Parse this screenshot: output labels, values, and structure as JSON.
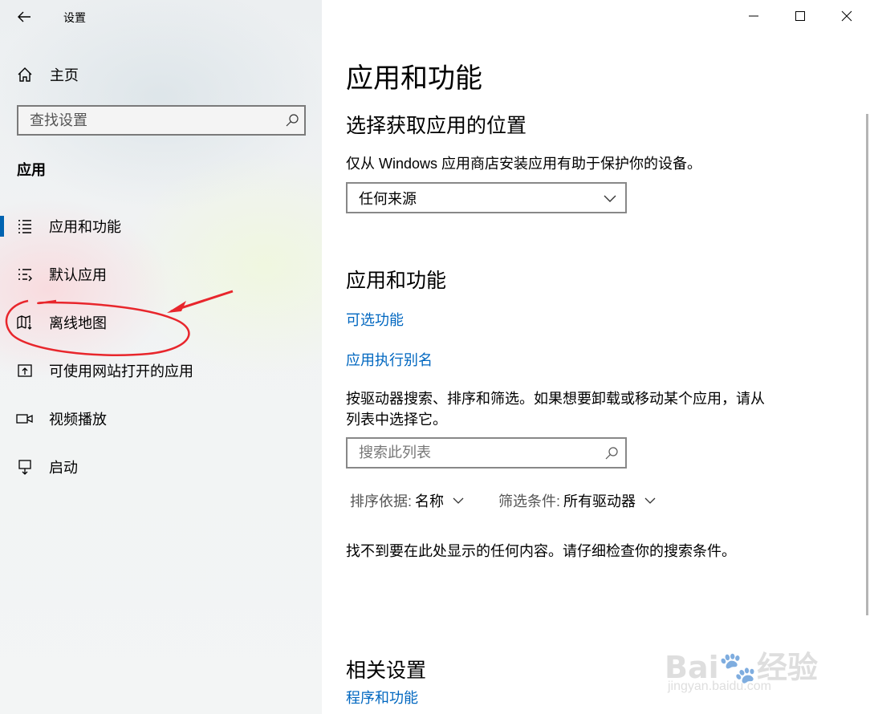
{
  "window": {
    "title": "设置",
    "controls": [
      "minimize",
      "maximize",
      "close"
    ]
  },
  "sidebar": {
    "home_label": "主页",
    "search_placeholder": "查找设置",
    "section_label": "应用",
    "items": [
      {
        "label": "应用和功能",
        "icon": "apps-list-icon",
        "active": true
      },
      {
        "label": "默认应用",
        "icon": "default-apps-icon",
        "active": false
      },
      {
        "label": "离线地图",
        "icon": "offline-map-icon",
        "active": false
      },
      {
        "label": "可使用网站打开的应用",
        "icon": "open-website-icon",
        "active": false
      },
      {
        "label": "视频播放",
        "icon": "video-icon",
        "active": false
      },
      {
        "label": "启动",
        "icon": "startup-icon",
        "active": false
      }
    ]
  },
  "main": {
    "page_title": "应用和功能",
    "install_section": {
      "heading": "选择获取应用的位置",
      "description": "仅从 Windows 应用商店安装应用有助于保护你的设备。",
      "dropdown_value": "任何来源"
    },
    "apps_section": {
      "heading": "应用和功能",
      "link_optional_features": "可选功能",
      "link_app_aliases": "应用执行别名",
      "description_line1": "按驱动器搜索、排序和筛选。如果想要卸载或移动某个应用，请从",
      "description_line2": "列表中选择它。",
      "search_placeholder": "搜索此列表",
      "sort_label": "排序依据:",
      "sort_value": "名称",
      "filter_label": "筛选条件:",
      "filter_value": "所有驱动器",
      "empty_message": "找不到要在此处显示的任何内容。请仔细检查你的搜索条件。"
    },
    "related_section": {
      "heading": "相关设置",
      "link_programs": "程序和功能"
    }
  },
  "watermark": {
    "brand": "Bai",
    "brand_suffix": "经验",
    "url": "jingyan.baidu.com"
  },
  "colors": {
    "accent": "#0063b1",
    "link": "#0067c0",
    "annotation": "#e8262c"
  }
}
